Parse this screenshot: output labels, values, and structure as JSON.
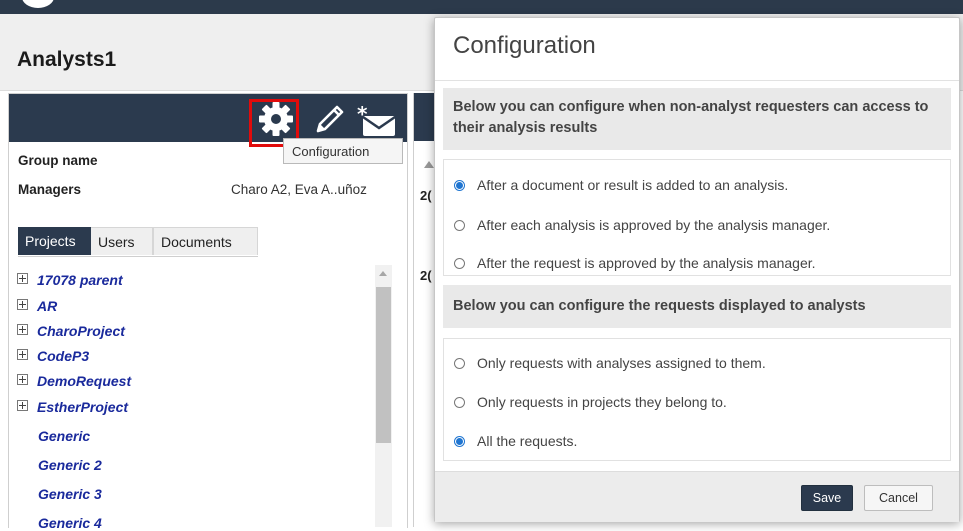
{
  "page": {
    "title": "Analysts1"
  },
  "toolbar": {
    "icons": [
      "gear-icon",
      "pencil-icon",
      "mail-star-icon"
    ],
    "tooltip": "Configuration"
  },
  "group": {
    "group_name_label": "Group name",
    "managers_label": "Managers",
    "managers_value": "Charo A2, Eva A..uñoz"
  },
  "tabs": [
    "Projects",
    "Users",
    "Documents"
  ],
  "projects": [
    {
      "label": "17078 parent",
      "expandable": true
    },
    {
      "label": "AR",
      "expandable": true
    },
    {
      "label": "CharoProject",
      "expandable": true
    },
    {
      "label": "CodeP3",
      "expandable": true
    },
    {
      "label": "DemoRequest",
      "expandable": true
    },
    {
      "label": "EstherProject",
      "expandable": true
    },
    {
      "label": "Generic",
      "expandable": false
    },
    {
      "label": "Generic 2",
      "expandable": false
    },
    {
      "label": "Generic 3",
      "expandable": false
    },
    {
      "label": "Generic 4",
      "expandable": false
    }
  ],
  "middle": {
    "row1": "2(",
    "row2": "2("
  },
  "modal": {
    "title": "Configuration",
    "section1": {
      "heading": "Below you can configure when non-analyst requesters can access to their analysis results",
      "options": [
        "After a document or result is added to an analysis.",
        "After each analysis is approved by the analysis manager.",
        "After the request is approved by the analysis manager."
      ],
      "selected_index": 0
    },
    "section2": {
      "heading": "Below you can configure the requests displayed to analysts",
      "options": [
        "Only requests with analyses assigned to them.",
        "Only requests in projects they belong to.",
        "All the requests."
      ],
      "selected_index": 2
    },
    "save_label": "Save",
    "cancel_label": "Cancel"
  },
  "colors": {
    "header_dark": "#2b3a4e",
    "highlight": "#e10b0b",
    "project_link": "#1a2a9c",
    "radio_accent": "#1f75d1"
  }
}
